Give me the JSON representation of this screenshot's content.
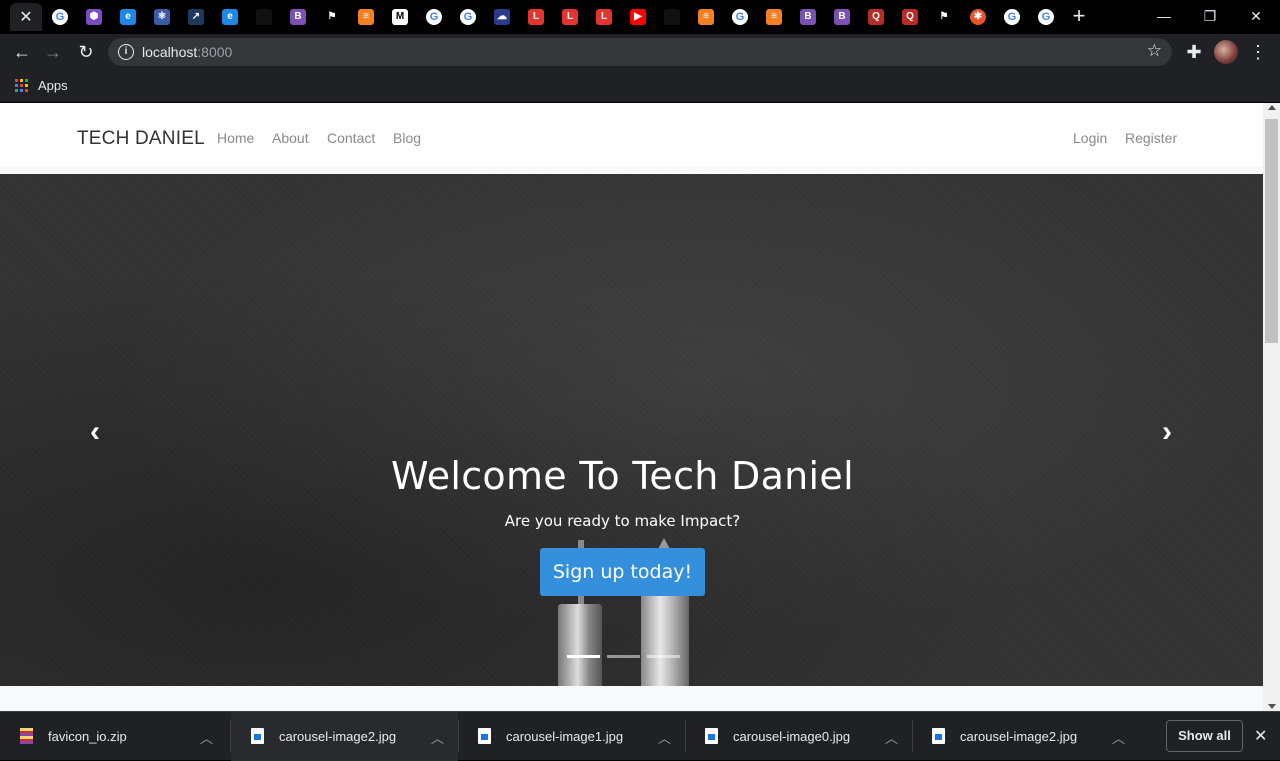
{
  "browser": {
    "tabs": [
      {
        "favicon": "close-icon",
        "glyph": "✕",
        "bg": "#202124",
        "color": "#e8eaed",
        "active": true
      },
      {
        "favicon": "google-icon",
        "glyph": "G",
        "kind": "g"
      },
      {
        "favicon": "hexagon-icon",
        "glyph": "⬢",
        "bg": "#7b4bbf"
      },
      {
        "favicon": "edge-icon",
        "glyph": "e",
        "bg": "#1e88e5"
      },
      {
        "favicon": "react-icon",
        "glyph": "⚛",
        "bg": "#3b5ba5"
      },
      {
        "favicon": "arrow-icon",
        "glyph": "↗",
        "bg": "#1e3a5f"
      },
      {
        "favicon": "edge-icon",
        "glyph": "e",
        "bg": "#1e88e5"
      },
      {
        "favicon": "blank-icon",
        "glyph": "",
        "bg": "#111"
      },
      {
        "favicon": "bootstrap-icon",
        "glyph": "B",
        "bg": "#7952b3"
      },
      {
        "favicon": "flag-icon",
        "glyph": "⚑",
        "bg": "#000"
      },
      {
        "favicon": "stackoverflow-icon",
        "glyph": "≡",
        "bg": "#f48024"
      },
      {
        "favicon": "medium-icon",
        "glyph": "M",
        "bg": "#fff",
        "color": "#000"
      },
      {
        "favicon": "google-icon",
        "glyph": "G",
        "kind": "g"
      },
      {
        "favicon": "google-icon",
        "glyph": "G",
        "kind": "g"
      },
      {
        "favicon": "cloud-icon",
        "glyph": "☁",
        "bg": "#2b3a8c"
      },
      {
        "favicon": "laravel-icon",
        "glyph": "L",
        "bg": "#e3342f"
      },
      {
        "favicon": "laravel-icon",
        "glyph": "L",
        "bg": "#e3342f"
      },
      {
        "favicon": "laravel-icon",
        "glyph": "L",
        "bg": "#e3342f"
      },
      {
        "favicon": "youtube-icon",
        "glyph": "▶",
        "bg": "#ff0000"
      },
      {
        "favicon": "blank-icon",
        "glyph": "",
        "bg": "#111"
      },
      {
        "favicon": "stackoverflow-icon",
        "glyph": "≡",
        "bg": "#f48024"
      },
      {
        "favicon": "google-icon",
        "glyph": "G",
        "kind": "g"
      },
      {
        "favicon": "stackoverflow-icon",
        "glyph": "≡",
        "bg": "#f48024"
      },
      {
        "favicon": "bootstrap-icon",
        "glyph": "B",
        "bg": "#7952b3"
      },
      {
        "favicon": "bootstrap-icon",
        "glyph": "B",
        "bg": "#7952b3"
      },
      {
        "favicon": "quora-icon",
        "glyph": "Q",
        "bg": "#b92b27"
      },
      {
        "favicon": "quora-icon",
        "glyph": "Q",
        "bg": "#b92b27"
      },
      {
        "favicon": "flag-icon",
        "glyph": "⚑",
        "bg": "#000"
      },
      {
        "favicon": "asterisk-icon",
        "glyph": "✱",
        "bg": "#e8552b",
        "kind": "circle"
      },
      {
        "favicon": "google-icon",
        "glyph": "G",
        "kind": "g"
      },
      {
        "favicon": "google-icon",
        "glyph": "G",
        "kind": "g"
      }
    ],
    "url_host": "localhost",
    "url_port": ":8000",
    "bookmarks_apps_label": "Apps",
    "apps_colors": [
      "#ea4335",
      "#fbbc05",
      "#34a853",
      "#4285f4",
      "#ea4335",
      "#fbbc05",
      "#34a853",
      "#4285f4",
      "#ea4335"
    ]
  },
  "site": {
    "brand": "TECH DANIEL",
    "nav_left": [
      "Home",
      "About",
      "Contact",
      "Blog"
    ],
    "nav_right": [
      "Login",
      "Register"
    ],
    "carousel": {
      "title": "Welcome To Tech Daniel",
      "subtitle": "Are you ready to make Impact?",
      "cta": "Sign up today!",
      "slide_count": 3,
      "active_slide": 1
    }
  },
  "downloads": {
    "items": [
      "favicon_io.zip",
      "carousel-image2.jpg",
      "carousel-image1.jpg",
      "carousel-image0.jpg",
      "carousel-image2.jpg"
    ],
    "show_all": "Show all"
  }
}
